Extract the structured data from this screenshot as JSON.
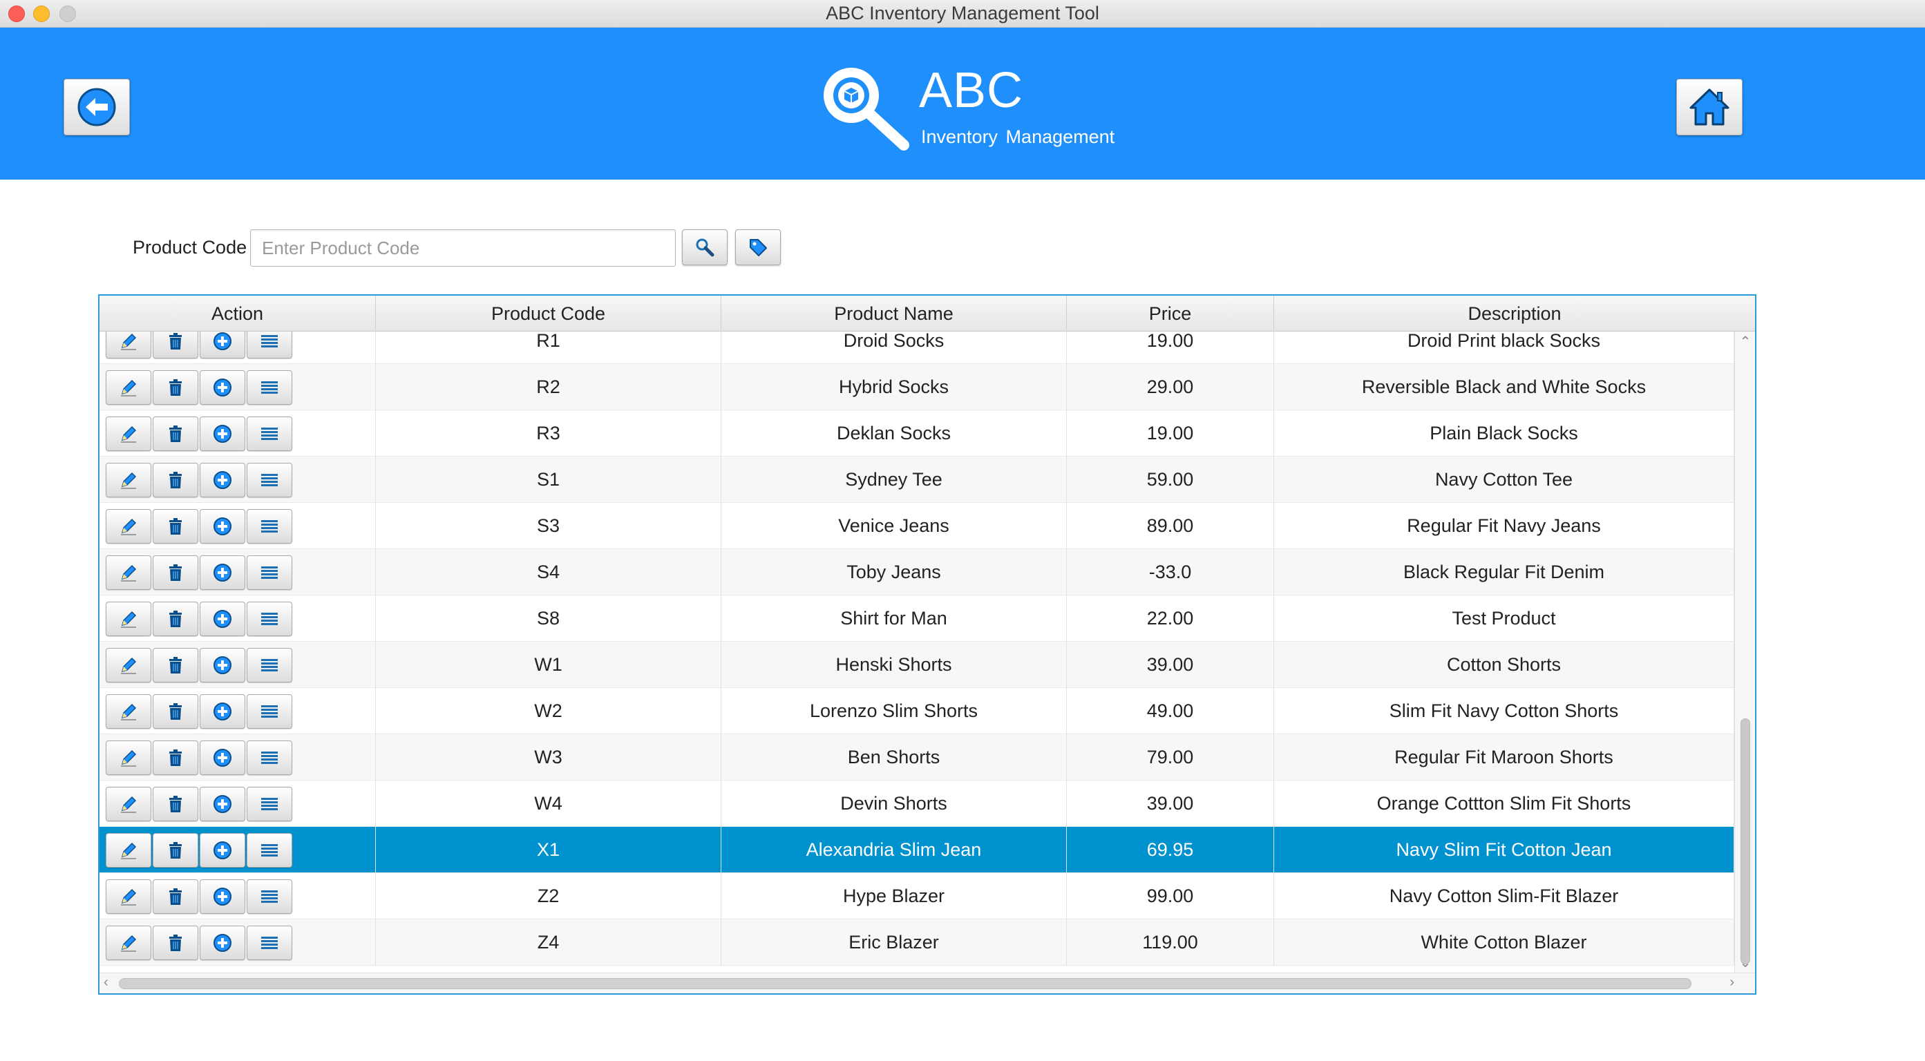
{
  "window": {
    "title": "ABC Inventory Management Tool"
  },
  "header": {
    "brand_title": "ABC",
    "brand_subtitle": "Inventory Management",
    "back_icon": "back-arrow-icon",
    "home_icon": "home-icon",
    "accent_color": "#1f8ffb"
  },
  "search": {
    "label": "Product Code",
    "placeholder": "Enter Product Code",
    "value": ""
  },
  "table": {
    "columns": [
      "Action",
      "Product Code",
      "Product Name",
      "Price",
      "Description"
    ],
    "selected_color": "#0091cf",
    "rows": [
      {
        "code": "R1",
        "name": "Droid Socks",
        "price": "19.00",
        "desc": "Droid Print black Socks"
      },
      {
        "code": "R2",
        "name": "Hybrid Socks",
        "price": "29.00",
        "desc": "Reversible Black and White Socks"
      },
      {
        "code": "R3",
        "name": "Deklan Socks",
        "price": "19.00",
        "desc": "Plain Black Socks"
      },
      {
        "code": "S1",
        "name": "Sydney Tee",
        "price": "59.00",
        "desc": "Navy Cotton Tee"
      },
      {
        "code": "S3",
        "name": "Venice Jeans",
        "price": "89.00",
        "desc": "Regular Fit Navy Jeans"
      },
      {
        "code": "S4",
        "name": "Toby Jeans",
        "price": "-33.0",
        "desc": "Black Regular Fit Denim"
      },
      {
        "code": "S8",
        "name": "Shirt for Man",
        "price": "22.00",
        "desc": "Test Product"
      },
      {
        "code": "W1",
        "name": "Henski Shorts",
        "price": "39.00",
        "desc": "Cotton Shorts"
      },
      {
        "code": "W2",
        "name": "Lorenzo Slim Shorts",
        "price": "49.00",
        "desc": "Slim Fit Navy Cotton Shorts"
      },
      {
        "code": "W3",
        "name": "Ben Shorts",
        "price": "79.00",
        "desc": "Regular Fit Maroon Shorts"
      },
      {
        "code": "W4",
        "name": "Devin Shorts",
        "price": "39.00",
        "desc": "Orange Cottton Slim Fit Shorts"
      },
      {
        "code": "X1",
        "name": "Alexandria Slim Jean",
        "price": "69.95",
        "desc": "Navy Slim Fit Cotton Jean",
        "selected": true
      },
      {
        "code": "Z2",
        "name": "Hype Blazer",
        "price": "99.00",
        "desc": "Navy Cotton Slim-Fit Blazer"
      },
      {
        "code": "Z4",
        "name": "Eric Blazer",
        "price": "119.00",
        "desc": "White Cotton Blazer"
      }
    ],
    "row_actions": [
      "edit-icon",
      "trash-icon",
      "plus-circle-icon",
      "list-icon"
    ]
  }
}
